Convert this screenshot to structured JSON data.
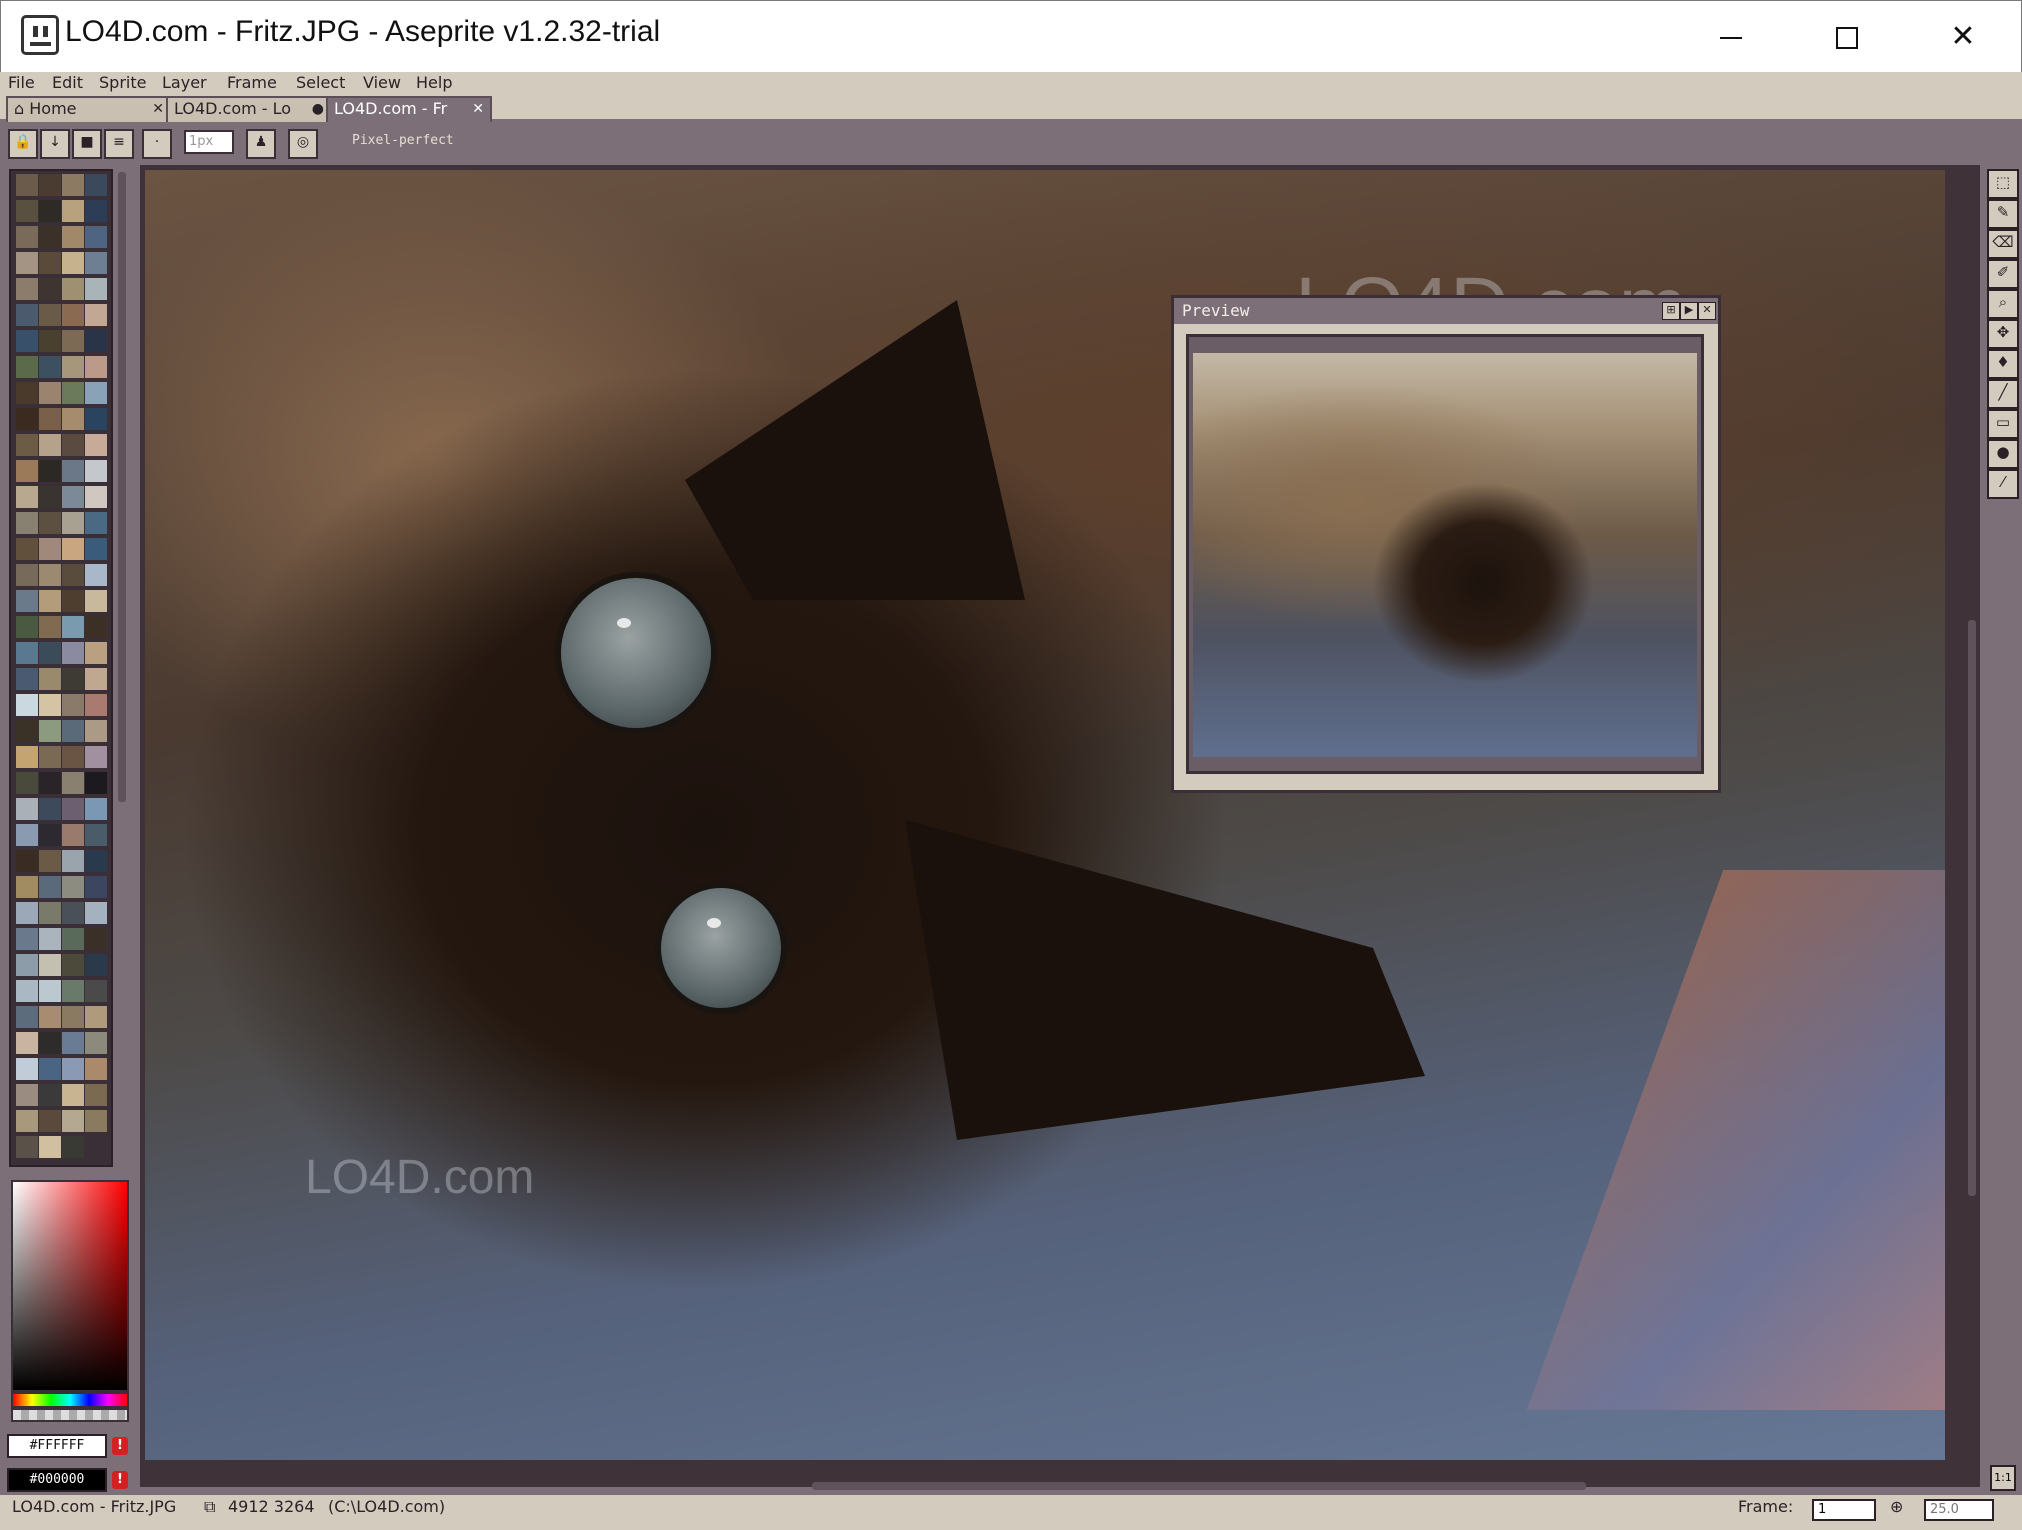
{
  "window": {
    "title": "LO4D.com - Fritz.JPG - Aseprite v1.2.32-trial",
    "minimize": "—",
    "maximize": "□",
    "close": "✕"
  },
  "menu": [
    "File",
    "Edit",
    "Sprite",
    "Layer",
    "Frame",
    "Select",
    "View",
    "Help"
  ],
  "tabs": [
    {
      "label": "Home",
      "icon": "home-icon",
      "close": "✕"
    },
    {
      "label": "LO4D.com - Lo",
      "close": "●"
    },
    {
      "label": "LO4D.com - Fr",
      "close": "✕",
      "active": true
    }
  ],
  "tool_options": {
    "brush_size_placeholder": "1px",
    "pixel_perfect_label": "Pixel-perfect"
  },
  "palette": {
    "colors": [
      "#6b5b4a",
      "#4a3c30",
      "#8c7b62",
      "#3a4a5c",
      "#5a5040",
      "#2e2a26",
      "#b8a27e",
      "#2c3d55",
      "#7a6a5a",
      "#3b3129",
      "#a08868",
      "#4e6480",
      "#a49484",
      "#5a4a3a",
      "#c6b28c",
      "#6e7f94",
      "#8c7c6c",
      "#3e3430",
      "#9e9070",
      "#a8b4b8",
      "#4c5a6e",
      "#6a5a48",
      "#8a6a50",
      "#c2a894",
      "#38506a",
      "#4a4030",
      "#7c6a54",
      "#2a3448",
      "#5c6a4c",
      "#3c5060",
      "#a6967a",
      "#bc9a8a",
      "#4a3a2c",
      "#9a8470",
      "#6a7a5a",
      "#8aa2b8",
      "#3a2a20",
      "#7a6048",
      "#a48c6c",
      "#2a4460",
      "#6c5c46",
      "#b4a28a",
      "#5a4a40",
      "#c8aa98",
      "#9a7a58",
      "#2c2824",
      "#6a7888",
      "#c4c8cc",
      "#b8a890",
      "#3a3430",
      "#7c8a98",
      "#d0c8c0",
      "#888070",
      "#5c5040",
      "#a8a090",
      "#4a6a84",
      "#60503c",
      "#a0887a",
      "#caa680",
      "#3a5c7a",
      "#786a5a",
      "#9c8a70",
      "#5a4c3c",
      "#a8b8c8",
      "#6a7a8a",
      "#b29c7a",
      "#4e3e30",
      "#c8b89c",
      "#4a5a40",
      "#806a50",
      "#7a9ab0",
      "#3c3026",
      "#5a7890",
      "#3a4c5a",
      "#8a8aa0",
      "#b8a080",
      "#4a5a70",
      "#9a8a6c",
      "#3e3a34",
      "#c0a890",
      "#cad8e0",
      "#d4c4a4",
      "#8a7a6a",
      "#a87a70",
      "#3a3226",
      "#8c9a80",
      "#5a6a78",
      "#aa9a86",
      "#c4a470",
      "#7a6a54",
      "#6a5444",
      "#a090a0",
      "#4a4a3c",
      "#2a2428",
      "#8a8070",
      "#1c1a1e",
      "#aab0b8",
      "#3c4a5c",
      "#6c6070",
      "#7a98b4",
      "#8a9ab0",
      "#2c2a30",
      "#9a7a6c",
      "#4a5c6a",
      "#3a2c22",
      "#6a5a46",
      "#9aa4ac",
      "#283a4c",
      "#a08c60",
      "#5a6a7a",
      "#8c8c80",
      "#3c4660",
      "#9aa8b8",
      "#7a7a6a",
      "#4a5058",
      "#a4b2c0",
      "#6a7a8c",
      "#aab4bc",
      "#5a6a5a",
      "#3a3028",
      "#8c9ca8",
      "#c4c0b0",
      "#4c4a3a",
      "#2a3a4a",
      "#aab8c4",
      "#bcc8d0",
      "#6a7a6a",
      "#4a4a4a",
      "#5c6c7c",
      "#a88c70",
      "#8a7a62",
      "#b09a7c",
      "#c8b4a0",
      "#2e2c2a",
      "#6a7c94",
      "#8c8a7c",
      "#c0ccd8",
      "#4a6484",
      "#8a9ab4",
      "#aa8a6a",
      "#9a8c80",
      "#3a3a3a",
      "#c8b490",
      "#7a6a52",
      "#a8987c",
      "#5a4a3c",
      "#b4a890",
      "#8a7a60",
      "#5a5248",
      "#d0c0a0",
      "#3a3a34"
    ],
    "foreground_hex": "#FFFFFF",
    "background_hex": "#000000",
    "warning_glyph": "!"
  },
  "preview": {
    "title": "Preview"
  },
  "tools": [
    {
      "icon": "marquee-icon",
      "glyph": "⬚"
    },
    {
      "icon": "pencil-icon",
      "glyph": "✎"
    },
    {
      "icon": "eraser-icon",
      "glyph": "⌫"
    },
    {
      "icon": "eyedropper-icon",
      "glyph": "✐"
    },
    {
      "icon": "zoom-icon",
      "glyph": "⌕"
    },
    {
      "icon": "move-icon",
      "glyph": "✥"
    },
    {
      "icon": "paint-bucket-icon",
      "glyph": "♦"
    },
    {
      "icon": "line-icon",
      "glyph": "╱"
    },
    {
      "icon": "rectangle-icon",
      "glyph": "▭"
    },
    {
      "icon": "contour-icon",
      "glyph": "●"
    },
    {
      "icon": "blur-icon",
      "glyph": "⁄"
    }
  ],
  "toolbar_buttons": [
    {
      "icon": "lock-icon",
      "glyph": "🔒"
    },
    {
      "icon": "arrow-down-icon",
      "glyph": "↓"
    },
    {
      "icon": "square-brush-icon",
      "glyph": "■"
    },
    {
      "icon": "lines-icon",
      "glyph": "≡"
    },
    {
      "icon": "dot-brush-icon",
      "glyph": "·"
    },
    {
      "icon": "ink-icon",
      "glyph": "♟"
    },
    {
      "icon": "opacity-icon",
      "glyph": "◎"
    }
  ],
  "status": {
    "file": "LO4D.com - Fritz.JPG",
    "size": "4912 3264",
    "path": "(C:\\LO4D.com)",
    "frame_label": "Frame:",
    "frame_value": "1",
    "zoom_value": "25.0",
    "zoom_button": "1:1"
  },
  "watermark": "LO4D.com"
}
